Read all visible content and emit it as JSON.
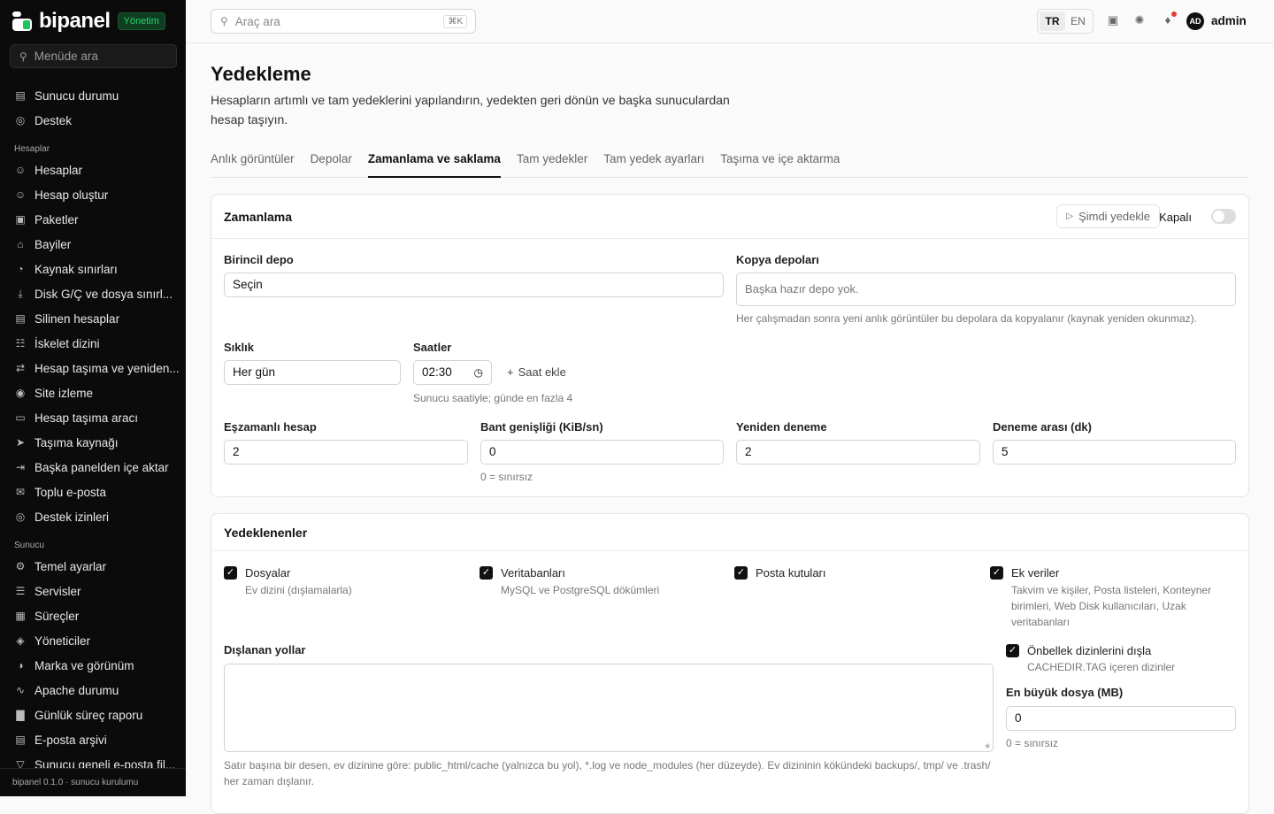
{
  "brand": {
    "name": "bipanel",
    "badge": "Yönetim"
  },
  "sidebar": {
    "search_placeholder": "Menüde ara",
    "items_top": [
      {
        "label": "Sunucu durumu",
        "icon": "server-icon"
      },
      {
        "label": "Destek",
        "icon": "lifebuoy-icon"
      }
    ],
    "section_accounts": "Hesaplar",
    "items_accounts": [
      {
        "label": "Hesaplar",
        "icon": "users-icon"
      },
      {
        "label": "Hesap oluştur",
        "icon": "user-plus-icon"
      },
      {
        "label": "Paketler",
        "icon": "package-icon"
      },
      {
        "label": "Bayiler",
        "icon": "store-icon"
      },
      {
        "label": "Kaynak sınırları",
        "icon": "gauge-icon"
      },
      {
        "label": "Disk G/Ç ve dosya sınırl...",
        "icon": "disk-icon"
      },
      {
        "label": "Silinen hesaplar",
        "icon": "archive-icon"
      },
      {
        "label": "İskelet dizini",
        "icon": "folder-tree-icon"
      },
      {
        "label": "Hesap taşıma ve yeniden...",
        "icon": "arrows-icon"
      },
      {
        "label": "Site izleme",
        "icon": "monitor-icon"
      },
      {
        "label": "Hesap taşıma aracı",
        "icon": "truck-icon"
      },
      {
        "label": "Taşıma kaynağı",
        "icon": "send-icon"
      },
      {
        "label": "Başka panelden içe aktar",
        "icon": "import-icon"
      },
      {
        "label": "Toplu e-posta",
        "icon": "mail-icon"
      },
      {
        "label": "Destek izinleri",
        "icon": "lifebuoy-icon"
      }
    ],
    "section_server": "Sunucu",
    "items_server": [
      {
        "label": "Temel ayarlar",
        "icon": "gear-icon"
      },
      {
        "label": "Servisler",
        "icon": "services-icon"
      },
      {
        "label": "Süreçler",
        "icon": "cpu-icon"
      },
      {
        "label": "Yöneticiler",
        "icon": "shield-icon"
      },
      {
        "label": "Marka ve görünüm",
        "icon": "palette-icon"
      },
      {
        "label": "Apache durumu",
        "icon": "activity-icon"
      },
      {
        "label": "Günlük süreç raporu",
        "icon": "chart-icon"
      },
      {
        "label": "E-posta arşivi",
        "icon": "archive-icon"
      },
      {
        "label": "Sunucu geneli e-posta fil...",
        "icon": "filter-icon"
      }
    ],
    "footer": "bipanel 0.1.0 · sunucu kurulumu"
  },
  "topbar": {
    "search_placeholder": "Araç ara",
    "shortcut": "⌘K",
    "lang_tr": "TR",
    "lang_en": "EN",
    "avatar": "AD",
    "user": "admin"
  },
  "page": {
    "title": "Yedekleme",
    "description": "Hesapların artımlı ve tam yedeklerini yapılandırın, yedekten geri dönün ve başka sunuculardan hesap taşıyın.",
    "tabs": [
      "Anlık görüntüler",
      "Depolar",
      "Zamanlama ve saklama",
      "Tam yedekler",
      "Tam yedek ayarları",
      "Taşıma ve içe aktarma"
    ],
    "active_tab": "Zamanlama ve saklama"
  },
  "schedule": {
    "title": "Zamanlama",
    "backup_now": "Şimdi yedekle",
    "status": "Kapalı",
    "primary_label": "Birincil depo",
    "primary_value": "Seçin",
    "copy_label": "Kopya depoları",
    "copy_placeholder": "Başka hazır depo yok.",
    "copy_hint": "Her çalışmadan sonra yeni anlık görüntüler bu depolara da kopyalanır (kaynak yeniden okunmaz).",
    "freq_label": "Sıklık",
    "freq_value": "Her gün",
    "hours_label": "Saatler",
    "hour_value": "02:30",
    "add_hour": "Saat ekle",
    "hours_hint": "Sunucu saatiyle; günde en fazla 4",
    "concurrent_label": "Eşzamanlı hesap",
    "concurrent_value": "2",
    "bandwidth_label": "Bant genişliği (KiB/sn)",
    "bandwidth_value": "0",
    "bandwidth_hint": "0 = sınırsız",
    "retry_label": "Yeniden deneme",
    "retry_value": "2",
    "interval_label": "Deneme arası (dk)",
    "interval_value": "5"
  },
  "backed": {
    "title": "Yedeklenenler",
    "files": "Dosyalar",
    "files_sub": "Ev dizini (dışlamalarla)",
    "db": "Veritabanları",
    "db_sub": "MySQL ve PostgreSQL dökümleri",
    "mail": "Posta kutuları",
    "extra": "Ek veriler",
    "extra_sub": "Takvim ve kişiler, Posta listeleri, Konteyner birimleri, Web Disk kullanıcıları, Uzak veritabanları",
    "excluded_label": "Dışlanan yollar",
    "excluded_hint": "Satır başına bir desen, ev dizinine göre: public_html/cache (yalnızca bu yol), *.log ve node_modules (her düzeyde). Ev dizininin kökündeki backups/, tmp/ ve .trash/ her zaman dışlanır.",
    "cache": "Önbellek dizinlerini dışla",
    "cache_sub": "CACHEDIR.TAG içeren dizinler",
    "maxfile_label": "En büyük dosya (MB)",
    "maxfile_value": "0",
    "maxfile_hint": "0 = sınırsız"
  }
}
